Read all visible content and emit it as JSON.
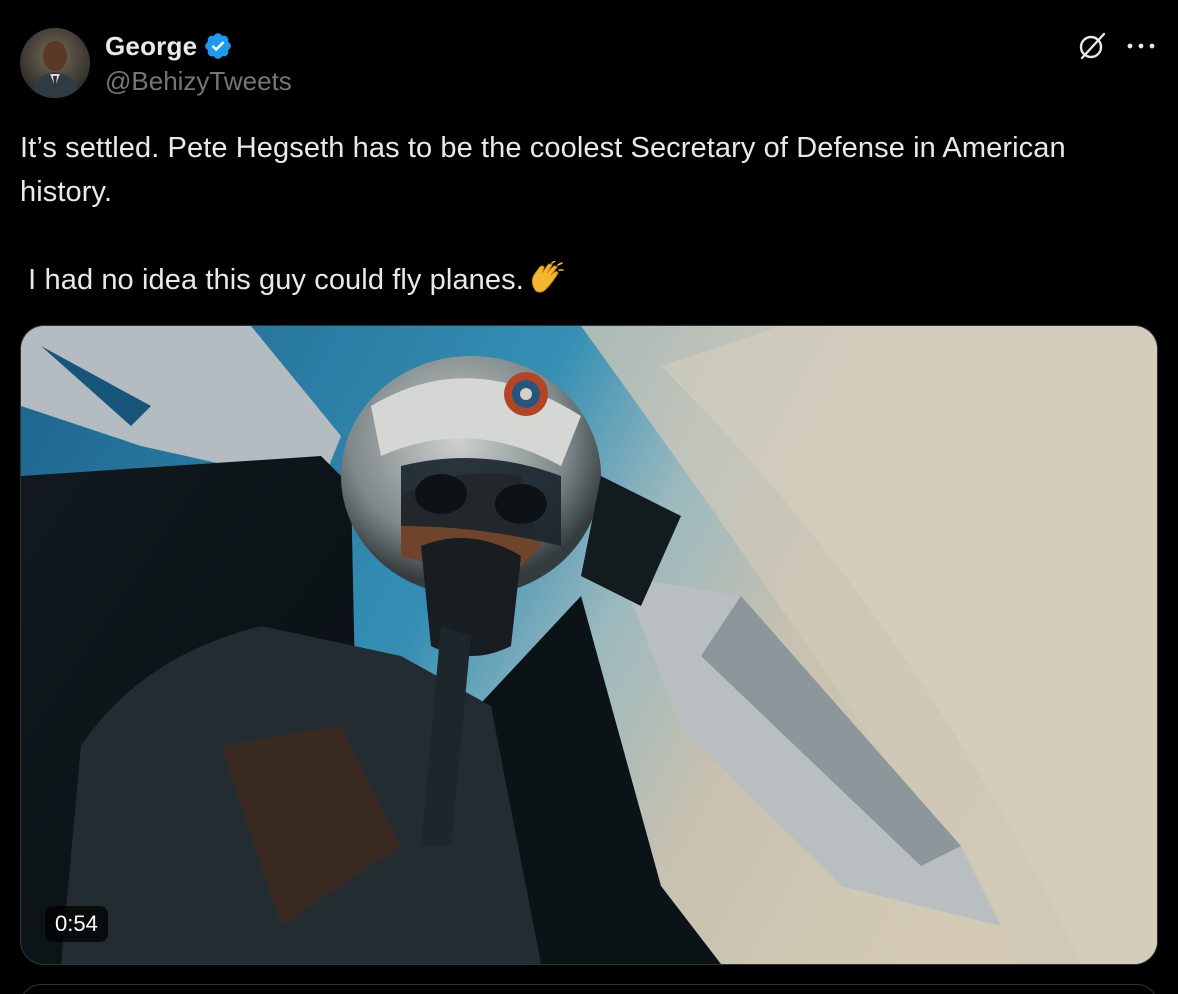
{
  "author": {
    "display_name": "George",
    "handle": "@BehizyTweets",
    "verified": true
  },
  "tweet": {
    "line1": "It’s settled. Pete Hegseth has to be the coolest Secretary of Defense in American history.",
    "line2": " I had no idea this guy could fly planes."
  },
  "media": {
    "type": "video",
    "duration": "0:54"
  },
  "icons": {
    "grok": "grok-icon",
    "more": "more-icon",
    "verified": "verified-badge-icon",
    "clap": "clapping-hands-emoji"
  },
  "colors": {
    "background": "#000000",
    "text": "#e7e9ea",
    "secondary_text": "#71767b",
    "verified_blue": "#1d9bf0"
  }
}
